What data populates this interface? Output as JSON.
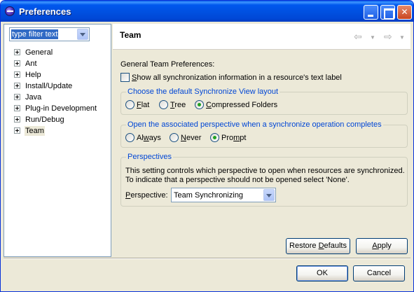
{
  "window": {
    "title": "Preferences"
  },
  "left": {
    "filter_text": "type filter text",
    "tree": [
      {
        "label": "General",
        "selected": false
      },
      {
        "label": "Ant",
        "selected": false
      },
      {
        "label": "Help",
        "selected": false
      },
      {
        "label": "Install/Update",
        "selected": false
      },
      {
        "label": "Java",
        "selected": false
      },
      {
        "label": "Plug-in Development",
        "selected": false
      },
      {
        "label": "Run/Debug",
        "selected": false
      },
      {
        "label": "Team",
        "selected": true
      }
    ]
  },
  "page": {
    "title": "Team",
    "general_label": "General Team Preferences:",
    "show_sync_checkbox": {
      "label_pre": "",
      "label_u": "S",
      "label_post": "how all synchronization information in a resource's text label",
      "checked": false
    },
    "layout_group": {
      "title": "Choose the default Synchronize View layout",
      "options": [
        {
          "u": "F",
          "rest": "lat",
          "selected": false
        },
        {
          "u": "T",
          "rest": "ree",
          "selected": false
        },
        {
          "u": "C",
          "rest": "ompressed Folders",
          "selected": true
        }
      ]
    },
    "perspective_open_group": {
      "title": "Open the associated perspective when a synchronize operation completes",
      "options": [
        {
          "pre": "Al",
          "u": "w",
          "rest": "ays",
          "selected": false
        },
        {
          "pre": "",
          "u": "N",
          "rest": "ever",
          "selected": false
        },
        {
          "pre": "Pro",
          "u": "m",
          "rest": "pt",
          "selected": true
        }
      ]
    },
    "perspectives_group": {
      "title": "Perspectives",
      "desc_line1": "This setting controls which perspective to open when resources are synchronized.",
      "desc_line2": "To indicate that a perspective should not be opened select 'None'.",
      "perspective_label_u": "P",
      "perspective_label_rest": "erspective:",
      "perspective_value": "Team Synchronizing"
    },
    "restore_defaults": {
      "pre": "Restore ",
      "u": "D",
      "rest": "efaults"
    },
    "apply": {
      "u": "A",
      "rest": "pply"
    }
  },
  "footer": {
    "ok_label": "OK",
    "cancel_label": "Cancel"
  },
  "colors": {
    "titlebar": "#0058ee",
    "group_title": "#0046d5",
    "selection": "#316ac5",
    "radio_dot": "#21a121"
  }
}
